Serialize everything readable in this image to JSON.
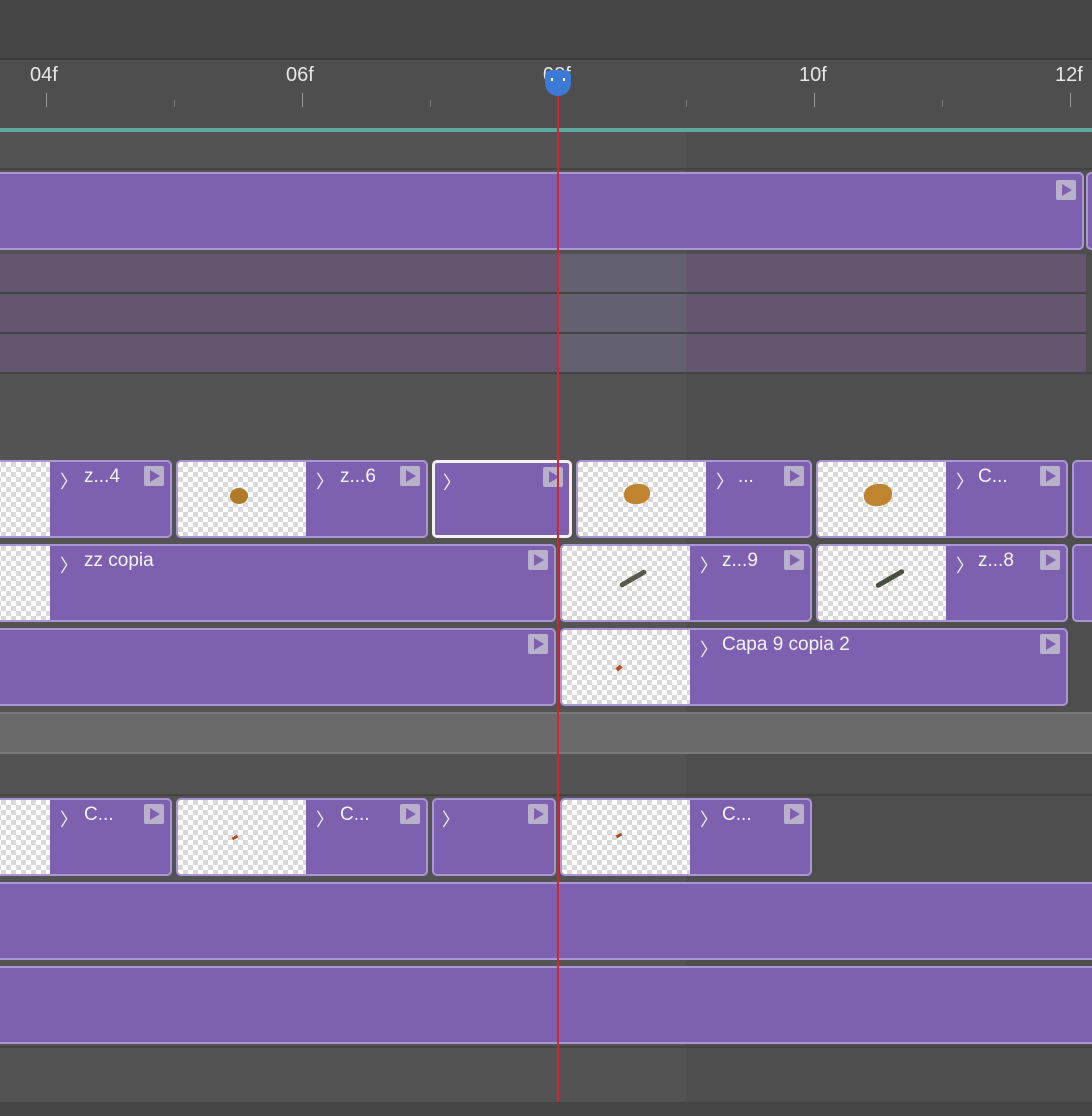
{
  "ruler": {
    "ticks": [
      {
        "label": "04f"
      },
      {
        "label": "06f"
      },
      {
        "label": "08f"
      },
      {
        "label": "10f"
      },
      {
        "label": "12f"
      }
    ]
  },
  "tracks": {
    "row1": {
      "labels": [
        "z...4",
        "z...6",
        "",
        "...",
        "C..."
      ]
    },
    "row2": {
      "labels": [
        "zz copia",
        "z...9",
        "z...8"
      ]
    },
    "row3": {
      "labels": [
        "Capa 9 copia 2"
      ]
    },
    "row4": {
      "labels": [
        "C...",
        "C...",
        "",
        "C..."
      ]
    }
  },
  "colors": {
    "clip": "#7d61b0",
    "playhead": "#d0262f",
    "playhead_handle": "#3d7ad6",
    "work_area": "#5fa8a0"
  }
}
